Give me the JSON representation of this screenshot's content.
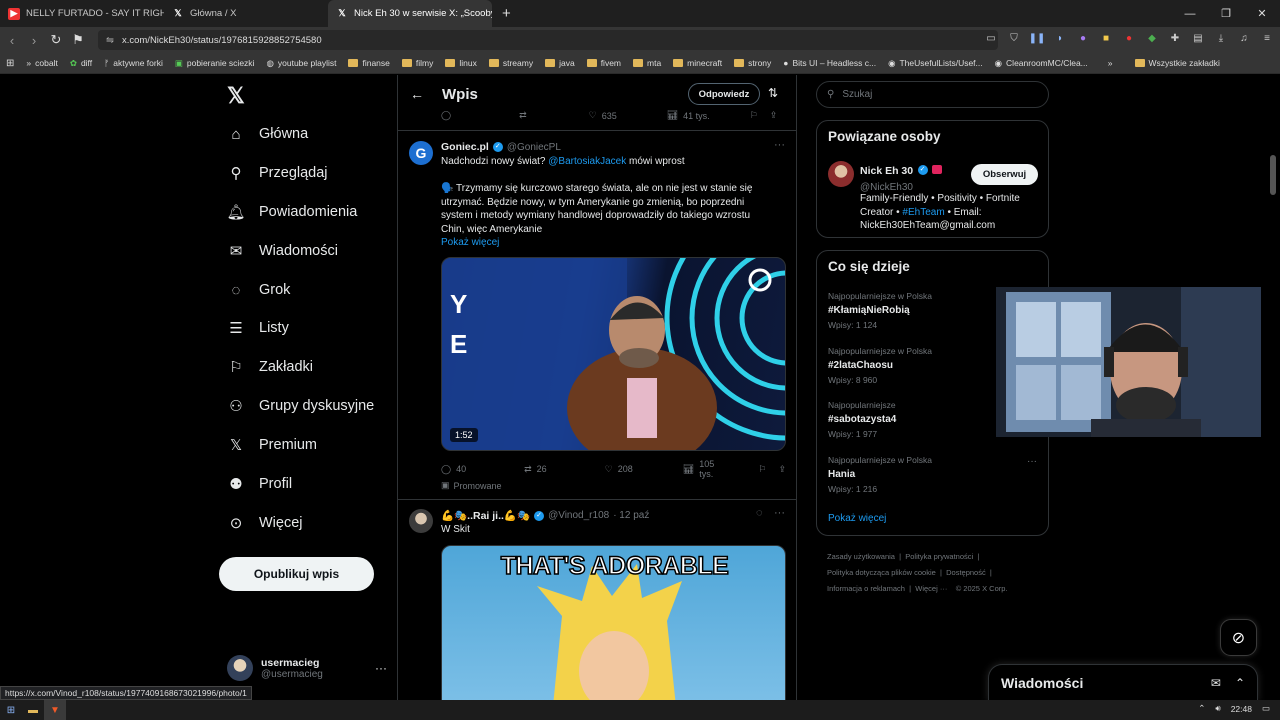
{
  "browser": {
    "tabs": [
      {
        "label": "NELLY FURTADO - SAY IT RIGHT (",
        "icon": "youtube-icon"
      },
      {
        "label": "Główna / X",
        "icon": "x-icon"
      },
      {
        "label": "Nick Eh 30 w serwisie X: „Scooby",
        "icon": "x-icon",
        "active": true
      }
    ],
    "url": "x.com/NickEh30/status/1976815928852754580",
    "bookmarks": [
      "cobalt",
      "diff",
      "aktywne forki",
      "pobieranie sciezki",
      "youtube playlist",
      "finanse",
      "filmy",
      "linux",
      "streamy",
      "java",
      "fivem",
      "mta",
      "minecraft",
      "strony",
      "Bits UI – Headless c...",
      "TheUsefulLists/Usef...",
      "CleanroomMC/Clea..."
    ],
    "bookmarks_all": "Wszystkie zakładki",
    "status_url": "https://x.com/Vinod_r108/status/1977409168673021996/photo/1"
  },
  "nav": {
    "items": [
      "Główna",
      "Przeglądaj",
      "Powiadomienia",
      "Wiadomości",
      "Grok",
      "Listy",
      "Zakładki",
      "Grupy dyskusyjne",
      "Premium",
      "Profil",
      "Więcej"
    ],
    "post_button": "Opublikuj wpis",
    "user_name": "usermacieg",
    "user_handle": "@usermacieg"
  },
  "center": {
    "title": "Wpis",
    "reply_button": "Odpowiedz",
    "top_actions": {
      "likes": "635",
      "views": "41 tys."
    },
    "tweet1": {
      "name": "Goniec.pl",
      "handle": "@GoniecPL",
      "line1_pre": "Nadchodzi nowy świat?",
      "line1_link": "@BartosiakJacek",
      "line1_post": "mówi wprost",
      "body": "🗣️ Trzymamy się kurczowo starego świata, ale on nie jest w stanie się utrzymać. Będzie nowy, w tym Amerykanie go zmienią, bo poprzedni system i metody wymiany handlowej doprowadziły do takiego wzrostu Chin, więc Amerykanie",
      "show_more": "Pokaż więcej",
      "duration": "1:52",
      "replies": "40",
      "retweets": "26",
      "likes": "208",
      "views": "105 tys.",
      "promoted": "Promowane"
    },
    "tweet2": {
      "name": "💪🎭..Rai ji..💪🎭",
      "handle": "@Vinod_r108",
      "time": "· 12 paź",
      "text": "W Skit",
      "meme_text": "THAT'S ADORABLE"
    }
  },
  "right": {
    "search_placeholder": "Szukaj",
    "related_title": "Powiązane osoby",
    "person_name": "Nick Eh 30",
    "person_handle": "@NickEh30",
    "follow": "Obserwuj",
    "bio_pre": "Family-Friendly • Positivity • Fortnite Creator •",
    "bio_link": "#EhTeam",
    "bio_post": "• Email: NickEh30EhTeam@gmail.com",
    "trends_title": "Co się dzieje",
    "trends": [
      {
        "cat": "Najpopularniejsze w Polska",
        "tag": "#KłamiąNieRobią",
        "count": "Wpisy: 1 124"
      },
      {
        "cat": "Najpopularniejsze w Polska",
        "tag": "#2lataChaosu",
        "count": "Wpisy: 8 960"
      },
      {
        "cat": "Najpopularniejsze",
        "tag": "#sabotazysta4",
        "count": "Wpisy: 1 977"
      },
      {
        "cat": "Najpopularniejsze w Polska",
        "tag": "Hania",
        "count": "Wpisy: 1 216"
      }
    ],
    "show_more": "Pokaż więcej",
    "footer_links": [
      "Zasady użytkowania",
      "Polityka prywatności",
      "Polityka dotycząca plików cookie",
      "Dostępność",
      "Informacja o reklamach",
      "Więcej ···",
      "© 2025 X Corp."
    ]
  },
  "dm": {
    "title": "Wiadomości"
  },
  "taskbar": {
    "time": "22:48"
  }
}
